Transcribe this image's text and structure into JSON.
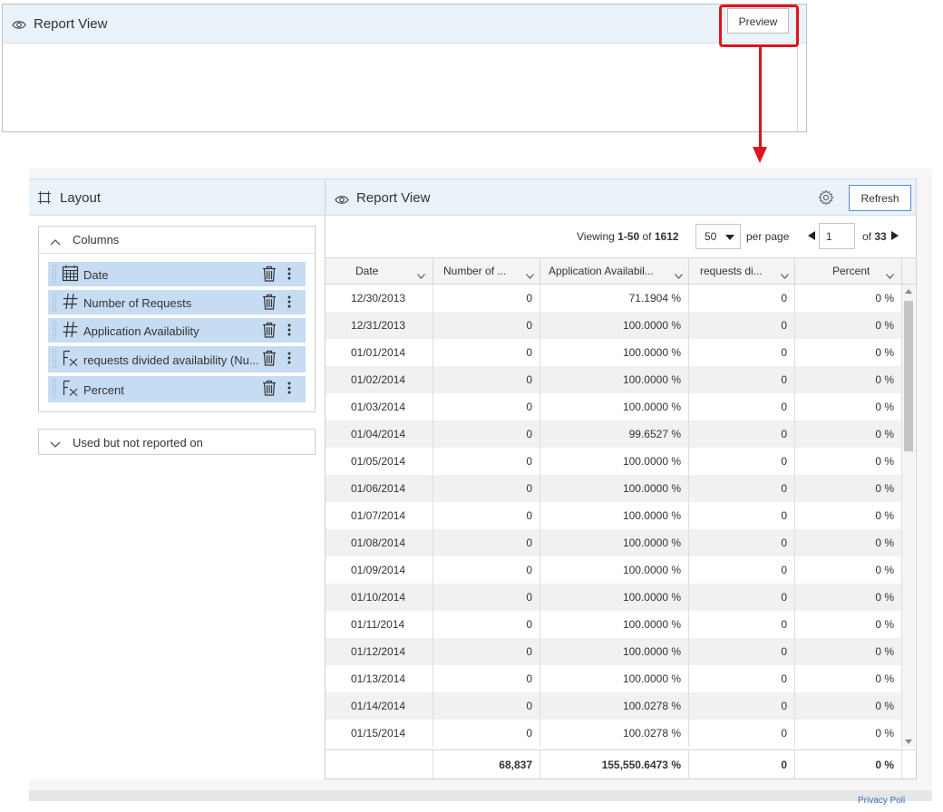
{
  "top_panel": {
    "title": "Report View",
    "preview_label": "Preview"
  },
  "layout_panel": {
    "title": "Layout",
    "columns_label": "Columns",
    "fields": [
      {
        "label": "Date",
        "icon": "calendar-icon"
      },
      {
        "label": "Number of Requests",
        "icon": "hash-icon"
      },
      {
        "label": "Application Availability",
        "icon": "hash-icon"
      },
      {
        "label": "requests divided availability (Nu...",
        "icon": "formula-icon"
      },
      {
        "label": "Percent",
        "icon": "formula-icon"
      }
    ],
    "used_label": "Used but not reported on"
  },
  "report_panel": {
    "title": "Report View",
    "refresh_label": "Refresh",
    "pager": {
      "viewing_prefix": "Viewing ",
      "range": "1-50",
      "of_word": " of ",
      "total": "1612",
      "page_size": "50",
      "per_page_label": "per page",
      "page": "1",
      "of_pages_prefix": "of ",
      "pages": "33"
    },
    "columns": [
      "Date",
      "Number of ...",
      "Application Availabil...",
      "requests di...",
      "Percent"
    ],
    "rows": [
      [
        "12/30/2013",
        "0",
        "71.1904 %",
        "0",
        "0 %"
      ],
      [
        "12/31/2013",
        "0",
        "100.0000 %",
        "0",
        "0 %"
      ],
      [
        "01/01/2014",
        "0",
        "100.0000 %",
        "0",
        "0 %"
      ],
      [
        "01/02/2014",
        "0",
        "100.0000 %",
        "0",
        "0 %"
      ],
      [
        "01/03/2014",
        "0",
        "100.0000 %",
        "0",
        "0 %"
      ],
      [
        "01/04/2014",
        "0",
        "99.6527 %",
        "0",
        "0 %"
      ],
      [
        "01/05/2014",
        "0",
        "100.0000 %",
        "0",
        "0 %"
      ],
      [
        "01/06/2014",
        "0",
        "100.0000 %",
        "0",
        "0 %"
      ],
      [
        "01/07/2014",
        "0",
        "100.0000 %",
        "0",
        "0 %"
      ],
      [
        "01/08/2014",
        "0",
        "100.0000 %",
        "0",
        "0 %"
      ],
      [
        "01/09/2014",
        "0",
        "100.0000 %",
        "0",
        "0 %"
      ],
      [
        "01/10/2014",
        "0",
        "100.0000 %",
        "0",
        "0 %"
      ],
      [
        "01/11/2014",
        "0",
        "100.0000 %",
        "0",
        "0 %"
      ],
      [
        "01/12/2014",
        "0",
        "100.0000 %",
        "0",
        "0 %"
      ],
      [
        "01/13/2014",
        "0",
        "100.0000 %",
        "0",
        "0 %"
      ],
      [
        "01/14/2014",
        "0",
        "100.0278 %",
        "0",
        "0 %"
      ],
      [
        "01/15/2014",
        "0",
        "100.0278 %",
        "0",
        "0 %"
      ]
    ],
    "totals": [
      "",
      "68,837",
      "155,550.6473 %",
      "0",
      "0 %"
    ]
  },
  "footer": {
    "privacy_label": "Privacy Poli"
  },
  "colors": {
    "highlight": "#e0121b",
    "header_bg": "#eaf2fa",
    "field_bg": "#c6dcf3",
    "refresh_border": "#5b8fd0"
  }
}
